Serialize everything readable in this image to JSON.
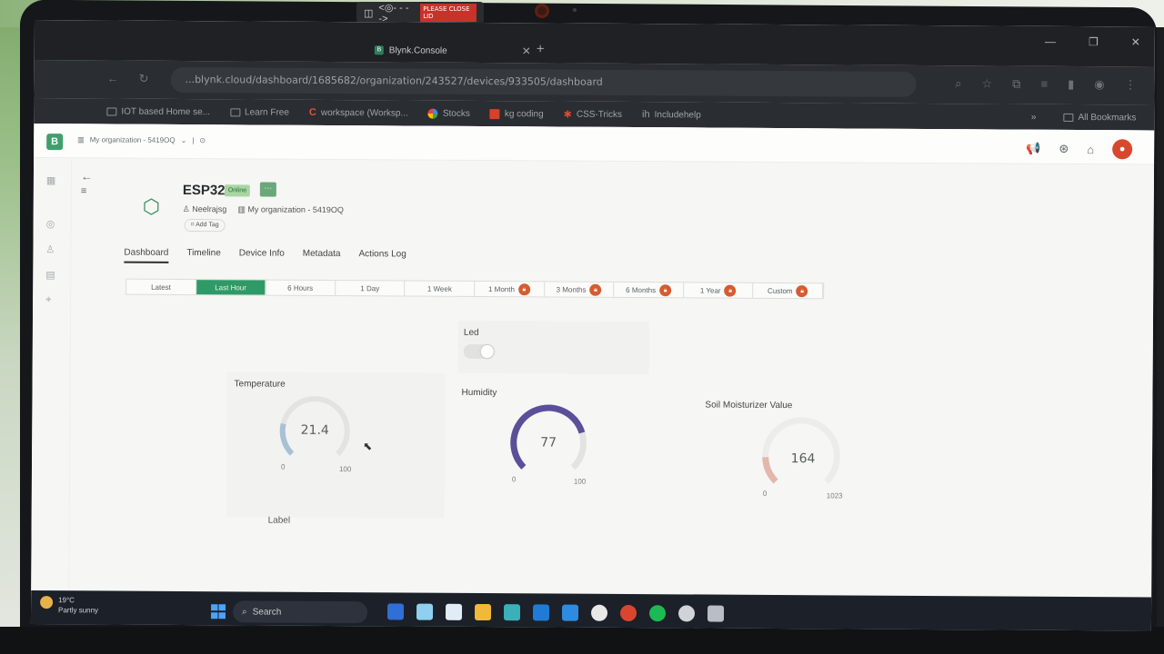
{
  "camera_sticker": "PLEASE CLOSE LID",
  "browser": {
    "tab_title": "Blynk.Console",
    "url": "...blynk.cloud/dashboard/1685682/organization/243527/devices/933505/dashboard",
    "bookmarks": [
      "IOT based Home se...",
      "Learn Free",
      "workspace (Worksp...",
      "Stocks",
      "kg coding",
      "CSS-Tricks",
      "Includehelp"
    ],
    "all_bookmarks": "All Bookmarks"
  },
  "app": {
    "org_selector": "My organization - 5419OQ",
    "device": {
      "name": "ESP32",
      "status": "Online",
      "owner": "Neelrajsg",
      "organization": "My organization - 5419OQ",
      "add_tag": "Add Tag"
    },
    "tabs": [
      "Dashboard",
      "Timeline",
      "Device Info",
      "Metadata",
      "Actions Log"
    ],
    "ranges": [
      {
        "label": "Latest",
        "locked": false
      },
      {
        "label": "Last Hour",
        "locked": false,
        "selected": true
      },
      {
        "label": "6 Hours",
        "locked": false
      },
      {
        "label": "1 Day",
        "locked": false
      },
      {
        "label": "1 Week",
        "locked": false
      },
      {
        "label": "1 Month",
        "locked": true
      },
      {
        "label": "3 Months",
        "locked": true
      },
      {
        "label": "6 Months",
        "locked": true
      },
      {
        "label": "1 Year",
        "locked": true
      },
      {
        "label": "Custom",
        "locked": true
      }
    ],
    "widgets": {
      "led": {
        "title": "Led",
        "on": false
      },
      "temperature": {
        "title": "Temperature",
        "value": "21.4",
        "min": "0",
        "max": "100",
        "fraction": 0.214,
        "color": "#a9c1d6",
        "label": "Label"
      },
      "humidity": {
        "title": "Humidity",
        "value": "77",
        "min": "0",
        "max": "100",
        "fraction": 0.77,
        "color": "#5b4f9a"
      },
      "soil": {
        "title": "Soil Moisturizer Value",
        "value": "164",
        "min": "0",
        "max": "1023",
        "fraction": 0.16,
        "color": "#e3b7ae"
      }
    }
  },
  "taskbar": {
    "weather_temp": "19°C",
    "weather_desc": "Partly sunny",
    "search": "Search"
  }
}
